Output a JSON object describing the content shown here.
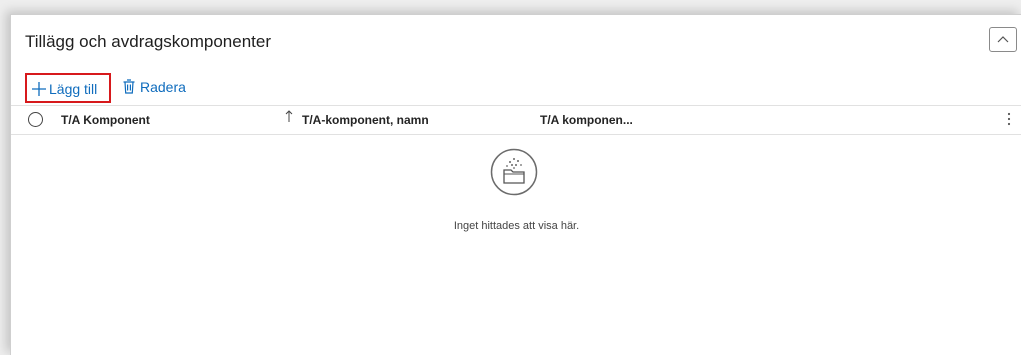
{
  "panel": {
    "title": "Tillägg och avdragskomponenter"
  },
  "toolbar": {
    "add_label": "Lägg till",
    "delete_label": "Radera"
  },
  "grid": {
    "columns": [
      {
        "label": "T/A Komponent",
        "sort": "ascending"
      },
      {
        "label": "T/A-komponent, namn"
      },
      {
        "label": "T/A komponen..."
      }
    ],
    "rows": [],
    "empty_message": "Inget hittades att visa här."
  },
  "colors": {
    "link": "#0f6cbd",
    "highlight": "#d7191c"
  },
  "icons": [
    "chevron-up-icon",
    "plus-icon",
    "trash-icon",
    "sort-ascending-icon",
    "more-vertical-icon",
    "empty-folder-icon"
  ]
}
